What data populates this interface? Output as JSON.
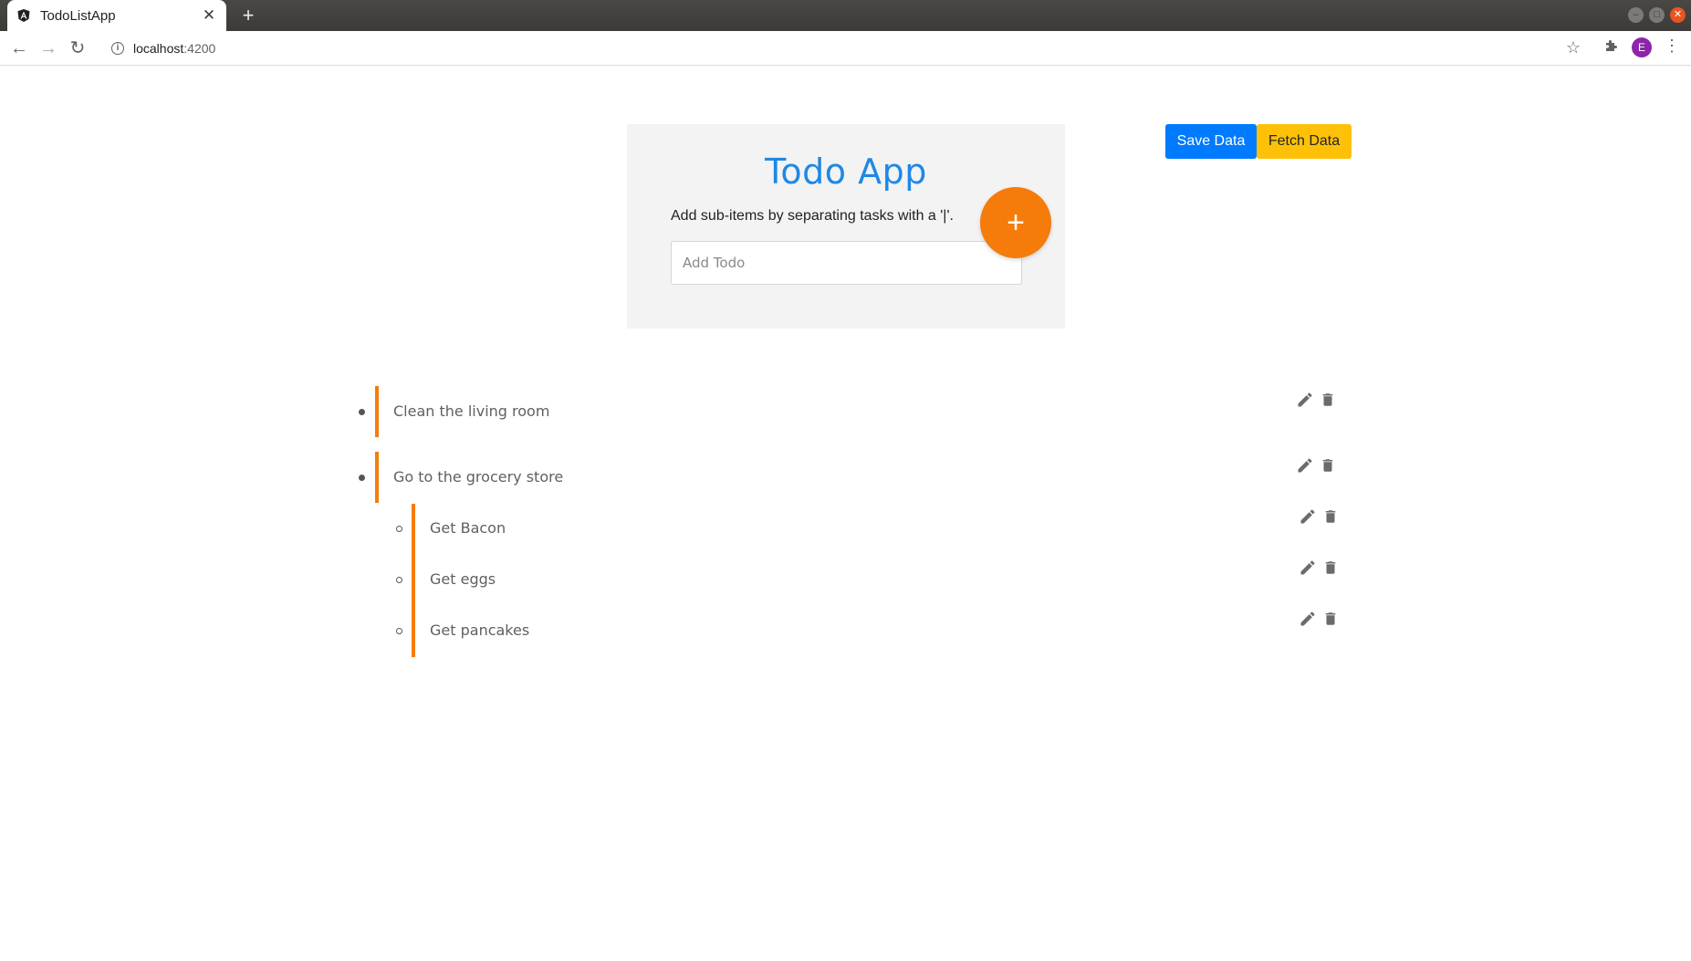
{
  "browser": {
    "tab_title": "TodoListApp",
    "tab_close": "✕",
    "new_tab": "+",
    "url_host": "localhost",
    "url_port": ":4200",
    "profile_initial": "E"
  },
  "app": {
    "title": "Todo App",
    "hint": "Add sub-items by separating tasks with a '|'.",
    "input_placeholder": "Add Todo",
    "input_value": "",
    "add_button": "+",
    "save_button": "Save Data",
    "fetch_button": "Fetch Data",
    "accent_color": "#f57c0b",
    "title_color": "#1e88e5"
  },
  "todos": [
    {
      "text": "Clean the living room",
      "subitems": []
    },
    {
      "text": "Go to the grocery store",
      "subitems": [
        "Get Bacon",
        "Get eggs",
        "Get pancakes"
      ]
    }
  ]
}
